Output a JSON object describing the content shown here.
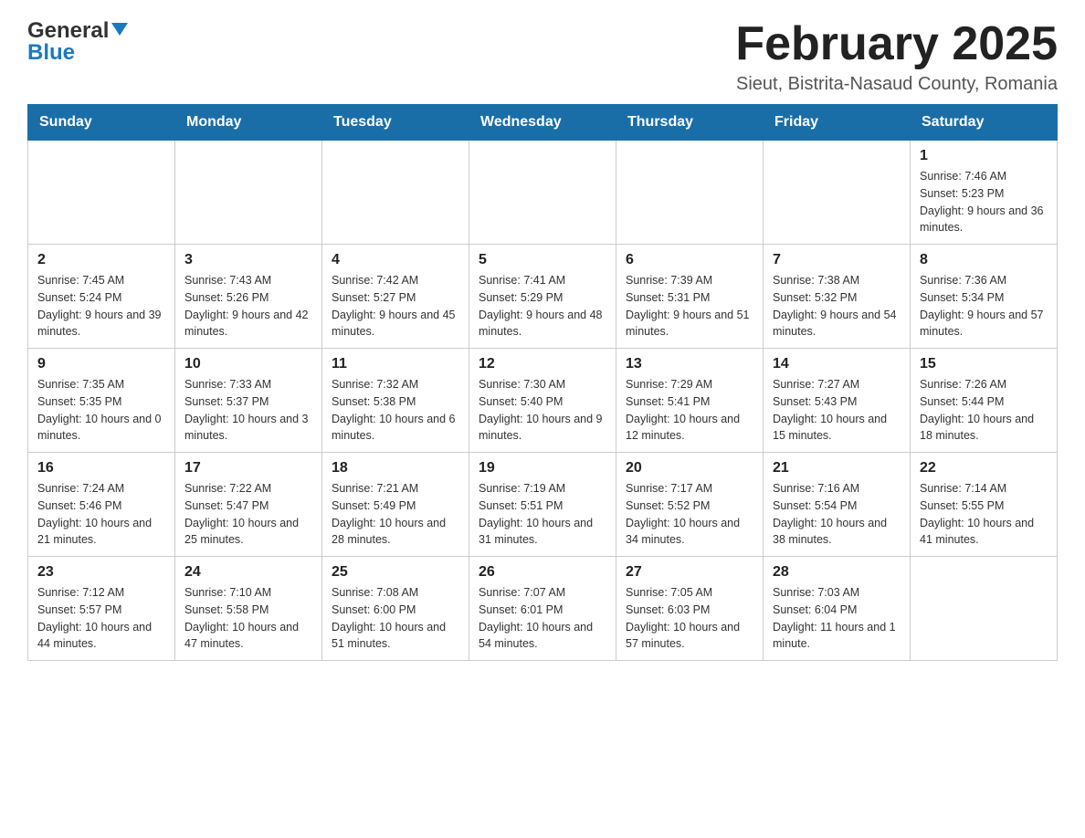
{
  "logo": {
    "general": "General",
    "blue": "Blue"
  },
  "header": {
    "title": "February 2025",
    "subtitle": "Sieut, Bistrita-Nasaud County, Romania"
  },
  "weekdays": [
    "Sunday",
    "Monday",
    "Tuesday",
    "Wednesday",
    "Thursday",
    "Friday",
    "Saturday"
  ],
  "weeks": [
    [
      {
        "day": "",
        "info": ""
      },
      {
        "day": "",
        "info": ""
      },
      {
        "day": "",
        "info": ""
      },
      {
        "day": "",
        "info": ""
      },
      {
        "day": "",
        "info": ""
      },
      {
        "day": "",
        "info": ""
      },
      {
        "day": "1",
        "info": "Sunrise: 7:46 AM\nSunset: 5:23 PM\nDaylight: 9 hours and 36 minutes."
      }
    ],
    [
      {
        "day": "2",
        "info": "Sunrise: 7:45 AM\nSunset: 5:24 PM\nDaylight: 9 hours and 39 minutes."
      },
      {
        "day": "3",
        "info": "Sunrise: 7:43 AM\nSunset: 5:26 PM\nDaylight: 9 hours and 42 minutes."
      },
      {
        "day": "4",
        "info": "Sunrise: 7:42 AM\nSunset: 5:27 PM\nDaylight: 9 hours and 45 minutes."
      },
      {
        "day": "5",
        "info": "Sunrise: 7:41 AM\nSunset: 5:29 PM\nDaylight: 9 hours and 48 minutes."
      },
      {
        "day": "6",
        "info": "Sunrise: 7:39 AM\nSunset: 5:31 PM\nDaylight: 9 hours and 51 minutes."
      },
      {
        "day": "7",
        "info": "Sunrise: 7:38 AM\nSunset: 5:32 PM\nDaylight: 9 hours and 54 minutes."
      },
      {
        "day": "8",
        "info": "Sunrise: 7:36 AM\nSunset: 5:34 PM\nDaylight: 9 hours and 57 minutes."
      }
    ],
    [
      {
        "day": "9",
        "info": "Sunrise: 7:35 AM\nSunset: 5:35 PM\nDaylight: 10 hours and 0 minutes."
      },
      {
        "day": "10",
        "info": "Sunrise: 7:33 AM\nSunset: 5:37 PM\nDaylight: 10 hours and 3 minutes."
      },
      {
        "day": "11",
        "info": "Sunrise: 7:32 AM\nSunset: 5:38 PM\nDaylight: 10 hours and 6 minutes."
      },
      {
        "day": "12",
        "info": "Sunrise: 7:30 AM\nSunset: 5:40 PM\nDaylight: 10 hours and 9 minutes."
      },
      {
        "day": "13",
        "info": "Sunrise: 7:29 AM\nSunset: 5:41 PM\nDaylight: 10 hours and 12 minutes."
      },
      {
        "day": "14",
        "info": "Sunrise: 7:27 AM\nSunset: 5:43 PM\nDaylight: 10 hours and 15 minutes."
      },
      {
        "day": "15",
        "info": "Sunrise: 7:26 AM\nSunset: 5:44 PM\nDaylight: 10 hours and 18 minutes."
      }
    ],
    [
      {
        "day": "16",
        "info": "Sunrise: 7:24 AM\nSunset: 5:46 PM\nDaylight: 10 hours and 21 minutes."
      },
      {
        "day": "17",
        "info": "Sunrise: 7:22 AM\nSunset: 5:47 PM\nDaylight: 10 hours and 25 minutes."
      },
      {
        "day": "18",
        "info": "Sunrise: 7:21 AM\nSunset: 5:49 PM\nDaylight: 10 hours and 28 minutes."
      },
      {
        "day": "19",
        "info": "Sunrise: 7:19 AM\nSunset: 5:51 PM\nDaylight: 10 hours and 31 minutes."
      },
      {
        "day": "20",
        "info": "Sunrise: 7:17 AM\nSunset: 5:52 PM\nDaylight: 10 hours and 34 minutes."
      },
      {
        "day": "21",
        "info": "Sunrise: 7:16 AM\nSunset: 5:54 PM\nDaylight: 10 hours and 38 minutes."
      },
      {
        "day": "22",
        "info": "Sunrise: 7:14 AM\nSunset: 5:55 PM\nDaylight: 10 hours and 41 minutes."
      }
    ],
    [
      {
        "day": "23",
        "info": "Sunrise: 7:12 AM\nSunset: 5:57 PM\nDaylight: 10 hours and 44 minutes."
      },
      {
        "day": "24",
        "info": "Sunrise: 7:10 AM\nSunset: 5:58 PM\nDaylight: 10 hours and 47 minutes."
      },
      {
        "day": "25",
        "info": "Sunrise: 7:08 AM\nSunset: 6:00 PM\nDaylight: 10 hours and 51 minutes."
      },
      {
        "day": "26",
        "info": "Sunrise: 7:07 AM\nSunset: 6:01 PM\nDaylight: 10 hours and 54 minutes."
      },
      {
        "day": "27",
        "info": "Sunrise: 7:05 AM\nSunset: 6:03 PM\nDaylight: 10 hours and 57 minutes."
      },
      {
        "day": "28",
        "info": "Sunrise: 7:03 AM\nSunset: 6:04 PM\nDaylight: 11 hours and 1 minute."
      },
      {
        "day": "",
        "info": ""
      }
    ]
  ]
}
